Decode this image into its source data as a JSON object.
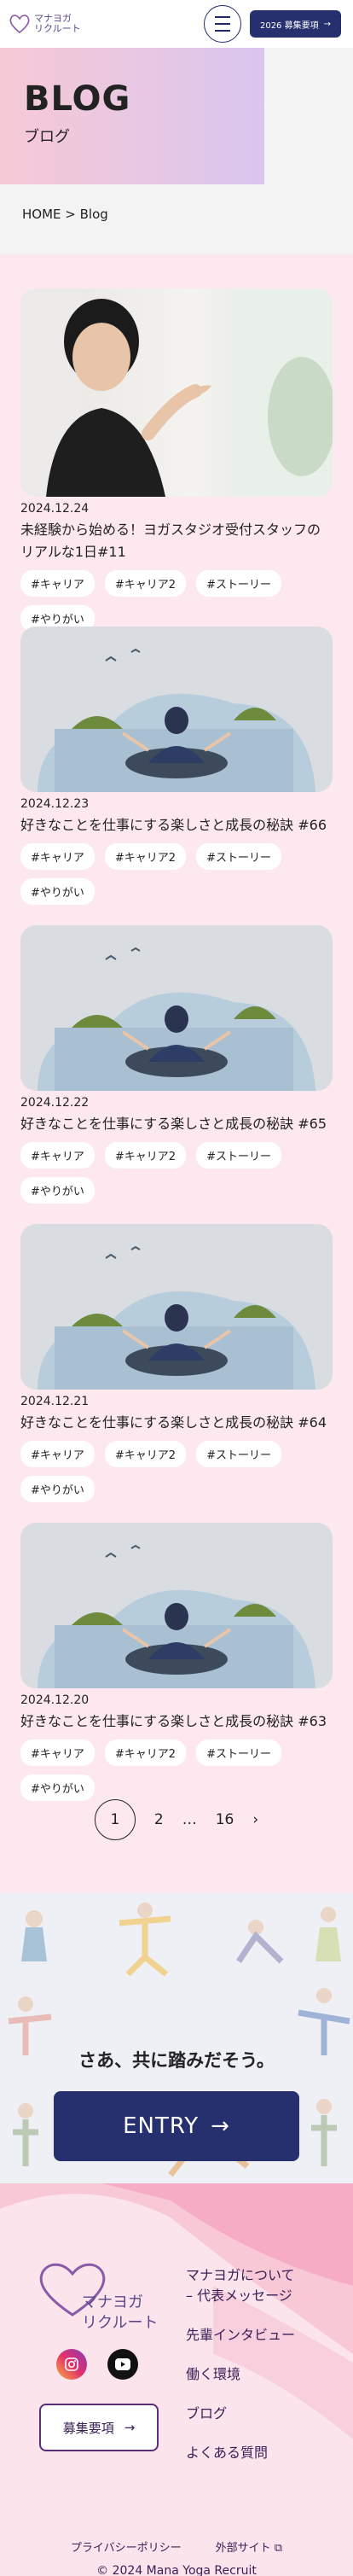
{
  "header": {
    "logo_line1": "マナヨガ",
    "logo_line2": "リクルート",
    "recruit_label": "2026 募集要項"
  },
  "hero": {
    "title_en": "BLOG",
    "title_ja": "ブログ"
  },
  "breadcrumb": "HOME > Blog",
  "posts": [
    {
      "date": "2024.12.24",
      "title": "未経験から始める！ヨガスタジオ受付スタッフのリアルな1日#11",
      "tags": [
        "#キャリア",
        "#キャリア2",
        "#ストーリー",
        "#やりがい"
      ]
    },
    {
      "date": "2024.12.23",
      "title": "好きなことを仕事にする楽しさと成長の秘訣 #66",
      "tags": [
        "#キャリア",
        "#キャリア2",
        "#ストーリー",
        "#やりがい"
      ]
    },
    {
      "date": "2024.12.22",
      "title": "好きなことを仕事にする楽しさと成長の秘訣 #65",
      "tags": [
        "#キャリア",
        "#キャリア2",
        "#ストーリー",
        "#やりがい"
      ]
    },
    {
      "date": "2024.12.21",
      "title": "好きなことを仕事にする楽しさと成長の秘訣 #64",
      "tags": [
        "#キャリア",
        "#キャリア2",
        "#ストーリー",
        "#やりがい"
      ]
    },
    {
      "date": "2024.12.20",
      "title": "好きなことを仕事にする楽しさと成長の秘訣 #63",
      "tags": [
        "#キャリア",
        "#キャリア2",
        "#ストーリー",
        "#やりがい"
      ]
    }
  ],
  "pagination": {
    "current": "1",
    "next": "2",
    "ellipsis": "…",
    "last": "16",
    "arrow": "›"
  },
  "cta": {
    "title": "さあ、共に踏みだそう。",
    "entry": "ENTRY",
    "arrow": "→"
  },
  "footer": {
    "logo_line1": "マナヨガ",
    "logo_line2": "リクルート",
    "recruit": "募集要項",
    "arrow": "→",
    "nav": [
      "マナヨガについて",
      "– 代表メッセージ",
      "先輩インタビュー",
      "働く環境",
      "ブログ",
      "よくある質問"
    ],
    "privacy": "プライバシーポリシー",
    "external": "外部サイト",
    "copyright": "© 2024 Mana Yoga Recruit"
  }
}
